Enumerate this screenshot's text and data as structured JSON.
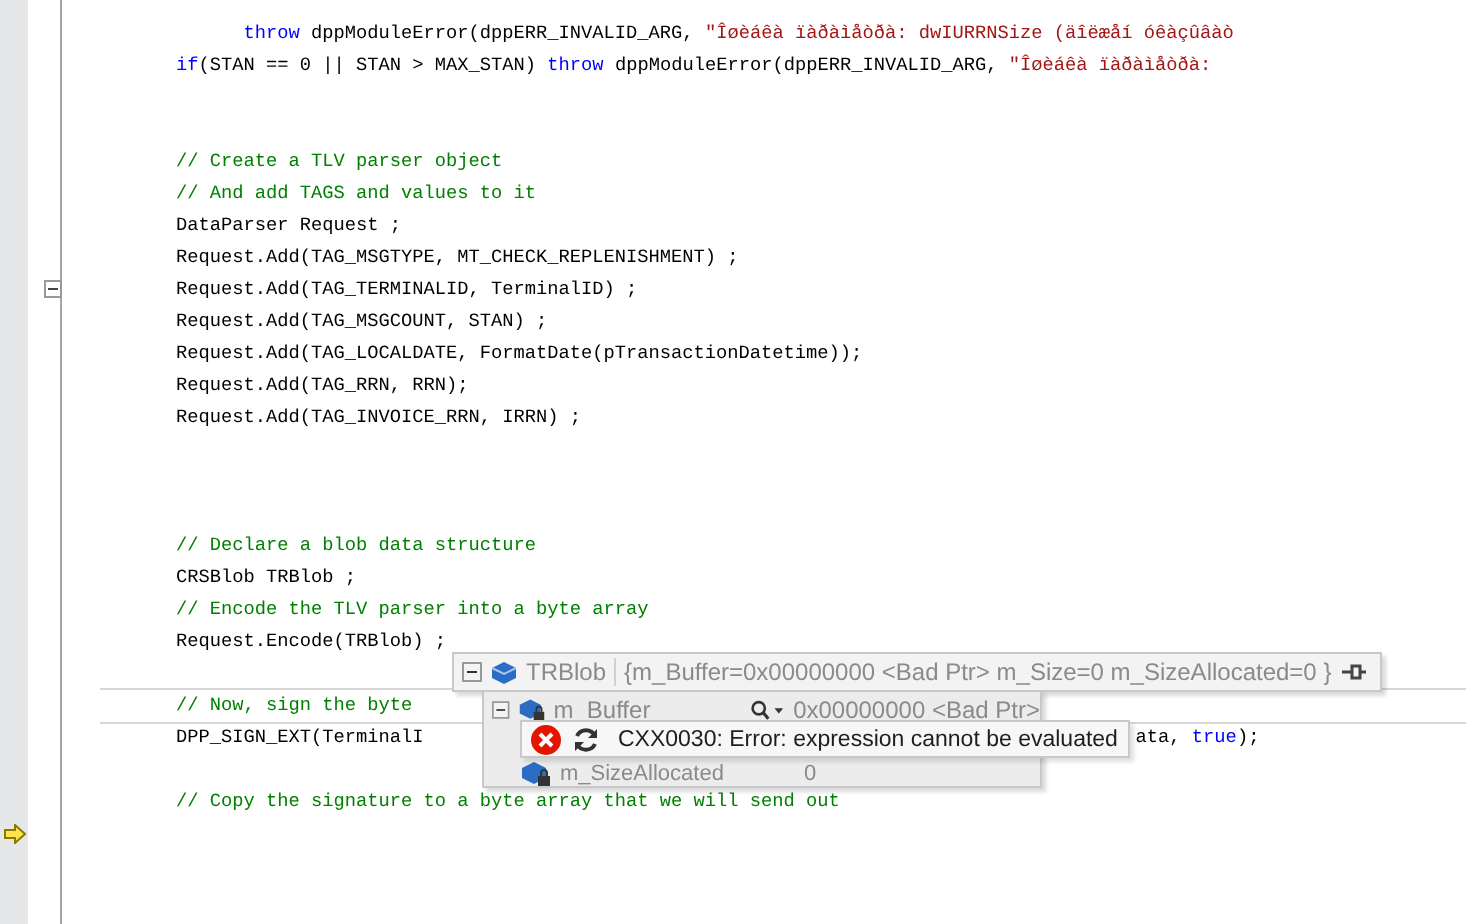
{
  "editor": {
    "lines": [
      {
        "highlighted": false,
        "current": false,
        "fold": false,
        "tokens": [
          {
            "t": "      throw",
            "kind": "keyword"
          },
          {
            "t": " dppModuleError(dppERR_INVALID_ARG, ",
            "kind": "code"
          },
          {
            "t": "\"Îøèáêà ïàðàìåòðà: dwIURRNSize (äîëæåí óêàçûâàò",
            "kind": "string"
          }
        ]
      },
      {
        "highlighted": false,
        "current": false,
        "fold": false,
        "tokens": [
          {
            "t": "if",
            "kind": "keyword"
          },
          {
            "t": "(STAN == 0 || STAN > MAX_STAN) ",
            "kind": "code"
          },
          {
            "t": "throw",
            "kind": "keyword"
          },
          {
            "t": " dppModuleError(dppERR_INVALID_ARG, ",
            "kind": "code"
          },
          {
            "t": "\"Îøèáêà ïàðàìåòðà:",
            "kind": "string"
          }
        ]
      },
      {
        "highlighted": false,
        "current": false,
        "fold": false
      },
      {
        "highlighted": false,
        "current": false,
        "fold": false
      },
      {
        "highlighted": false,
        "current": false,
        "fold": false,
        "tokens": [
          {
            "t": "// Create a TLV parser object",
            "kind": "comment"
          }
        ]
      },
      {
        "highlighted": false,
        "current": false,
        "fold": false,
        "tokens": [
          {
            "t": "// And add TAGS and values to it",
            "kind": "comment"
          }
        ]
      },
      {
        "highlighted": false,
        "current": false,
        "fold": false,
        "tokens": [
          {
            "t": "DataParser Request ;",
            "kind": "code"
          }
        ]
      },
      {
        "highlighted": false,
        "current": false,
        "fold": false,
        "tokens": [
          {
            "t": "Request.Add(TAG_MSGTYPE, MT_CHECK_REPLENISHMENT) ;",
            "kind": "code"
          }
        ]
      },
      {
        "highlighted": false,
        "current": false,
        "fold": true,
        "tokens": [
          {
            "t": "Request.Add(TAG_TERMINALID, TerminalID) ;",
            "kind": "code"
          }
        ]
      },
      {
        "highlighted": false,
        "current": false,
        "fold": false,
        "tokens": [
          {
            "t": "Request.Add(TAG_MSGCOUNT, STAN) ;",
            "kind": "code"
          }
        ]
      },
      {
        "highlighted": false,
        "current": false,
        "fold": false,
        "tokens": [
          {
            "t": "Request.Add(TAG_LOCALDATE, FormatDate(pTransactionDatetime));",
            "kind": "code"
          }
        ]
      },
      {
        "highlighted": false,
        "current": false,
        "fold": false,
        "tokens": [
          {
            "t": "Request.Add(TAG_RRN, RRN);",
            "kind": "code"
          }
        ]
      },
      {
        "highlighted": false,
        "current": false,
        "fold": false,
        "tokens": [
          {
            "t": "Request.Add(TAG_INVOICE_RRN, IRRN) ;",
            "kind": "code"
          }
        ]
      },
      {
        "highlighted": false,
        "current": false,
        "fold": false
      },
      {
        "highlighted": false,
        "current": false,
        "fold": false
      },
      {
        "highlighted": false,
        "current": false,
        "fold": false
      },
      {
        "highlighted": false,
        "current": false,
        "fold": false,
        "tokens": [
          {
            "t": "// Declare a blob data structure",
            "kind": "comment"
          }
        ]
      },
      {
        "highlighted": false,
        "current": false,
        "fold": false,
        "tokens": [
          {
            "t": "CRSBlob TRBlob ;",
            "kind": "code"
          }
        ]
      },
      {
        "highlighted": false,
        "current": false,
        "fold": false,
        "tokens": [
          {
            "t": "// Encode the TLV parser into a byte array",
            "kind": "comment"
          }
        ]
      },
      {
        "highlighted": false,
        "current": false,
        "fold": false,
        "tokens": [
          {
            "t": "Request.Encode(TRBlob) ;",
            "kind": "code"
          }
        ]
      },
      {
        "highlighted": false,
        "current": false,
        "fold": false
      },
      {
        "highlighted": true,
        "current": false,
        "fold": false,
        "tokens": [
          {
            "t": "// Now, sign the byte",
            "kind": "comment"
          }
        ]
      },
      {
        "highlighted": false,
        "current": false,
        "fold": false,
        "tokens": [
          {
            "t": "DPP_SIGN_EXT(TerminalI",
            "kind": "code"
          },
          {
            "t": "ata, ",
            "kind": "tail"
          },
          {
            "t": "true",
            "kind": "keyword"
          },
          {
            "t": ");",
            "kind": "code"
          }
        ]
      },
      {
        "highlighted": false,
        "current": false,
        "fold": false
      },
      {
        "highlighted": false,
        "current": false,
        "fold": false,
        "tokens": [
          {
            "t": "// Copy the signature to a byte array that we will send out",
            "kind": "comment"
          }
        ]
      },
      {
        "highlighted": false,
        "current": true,
        "fold": false
      }
    ]
  },
  "datatip": {
    "root": {
      "name": "TRBlob",
      "value": "{m_Buffer=0x00000000 <Bad Ptr> m_Size=0 m_SizeAllocated=0 }",
      "expanded": true
    },
    "members": [
      {
        "kind": "pointer",
        "name": "m_Buffer",
        "value": "0x00000000 <Bad Ptr>"
      },
      {
        "kind": "plain",
        "name": "m_SizeAllocated",
        "value": "0"
      }
    ],
    "error": {
      "message": "CXX0030: Error: expression cannot be evaluated"
    }
  }
}
